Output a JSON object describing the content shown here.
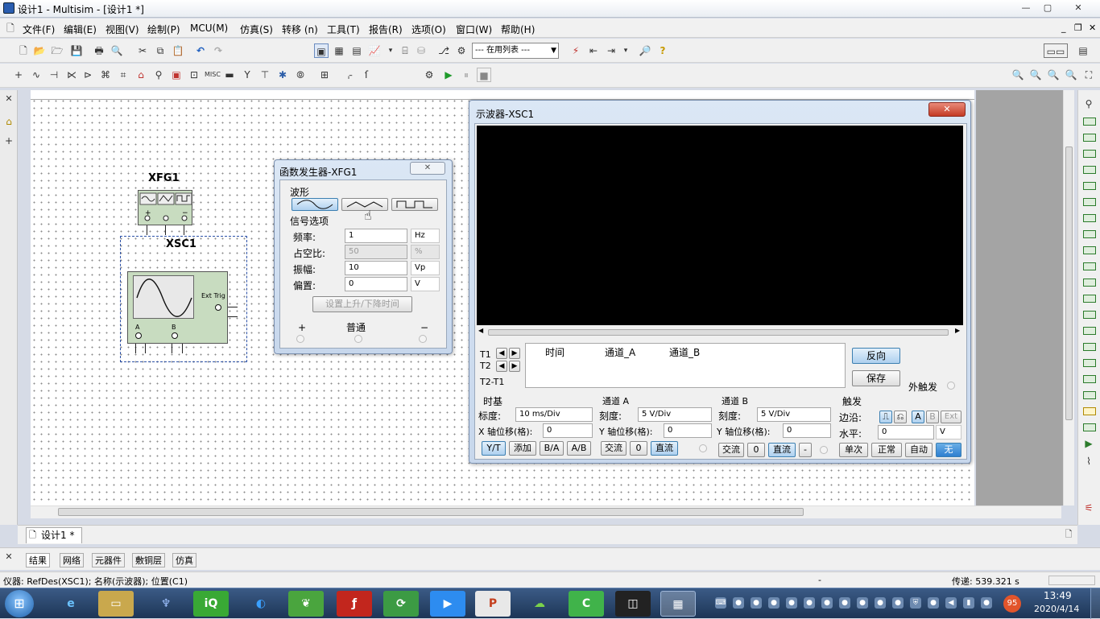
{
  "window": {
    "title": "设计1 - Multisim - [设计1 *]",
    "min": "—",
    "max": "▢",
    "close": "✕"
  },
  "menu": [
    "文件(F)",
    "编辑(E)",
    "视图(V)",
    "绘制(P)",
    "MCU(M)",
    "仿真(S)",
    "转移 (n)",
    "工具(T)",
    "报告(R)",
    "选项(O)",
    "窗口(W)",
    "帮助(H)"
  ],
  "toolbar": {
    "in_use_list": "--- 在用列表 ---"
  },
  "generator": {
    "title": "函数发生器-XFG1",
    "label": "XFG1",
    "waveform_label": "波形",
    "signal_options_label": "信号选项",
    "frequency_label": "频率:",
    "frequency_value": "1",
    "frequency_unit": "Hz",
    "duty_label": "占空比:",
    "duty_value": "50",
    "duty_unit": "%",
    "amplitude_label": "振幅:",
    "amplitude_value": "10",
    "amplitude_unit": "Vp",
    "offset_label": "偏置:",
    "offset_value": "0",
    "offset_unit": "V",
    "rise_fall_button": "设置上升/下降时间",
    "plus_label": "+",
    "common_label": "普通",
    "minus_label": "−"
  },
  "oscilloscope_symbol": {
    "label": "XSC1",
    "ext_trig": "Ext Trig",
    "a": "A",
    "b": "B"
  },
  "scope": {
    "title": "示波器-XSC1",
    "t1": "T1",
    "t2": "T2",
    "t2t1": "T2-T1",
    "col_time": "时间",
    "col_a": "通道_A",
    "col_b": "通道_B",
    "reverse": "反向",
    "save": "保存",
    "ext_trigger": "外触发",
    "timebase_label": "时基",
    "scale_label": "标度:",
    "scale_value": "10 ms/Div",
    "xpos_label": "X 轴位移(格):",
    "xpos_value": "0",
    "yt": "Y/T",
    "add": "添加",
    "ba": "B/A",
    "ab": "A/B",
    "chA_label": "通道 A",
    "chA_scale_label": "刻度:",
    "chA_scale_value": "5  V/Div",
    "chA_ypos_label": "Y 轴位移(格):",
    "chA_ypos_value": "0",
    "chB_label": "通道 B",
    "chB_scale_label": "刻度:",
    "chB_scale_value": "5  V/Div",
    "chB_ypos_label": "Y 轴位移(格):",
    "chB_ypos_value": "0",
    "ac": "交流",
    "zero": "0",
    "dc": "直流",
    "minus": "-",
    "trigger_label": "触发",
    "edge_label": "边沿:",
    "level_label": "水平:",
    "level_value": "0",
    "level_unit": "V",
    "trig_a": "A",
    "trig_b": "B",
    "trig_ext": "Ext",
    "single": "单次",
    "normal": "正常",
    "auto": "自动",
    "none": "无"
  },
  "doc_tab": "设计1 *",
  "bottom_tabs": [
    "结果",
    "网络",
    "元器件",
    "敷铜层",
    "仿真"
  ],
  "status": {
    "left": "仪器: RefDes(XSC1); 名称(示波器); 位置(C1)",
    "mid": "-",
    "right": "传递: 539.321 s"
  },
  "taskbar": {
    "time": "13:49",
    "date": "2020/4/14",
    "badge": "95"
  }
}
